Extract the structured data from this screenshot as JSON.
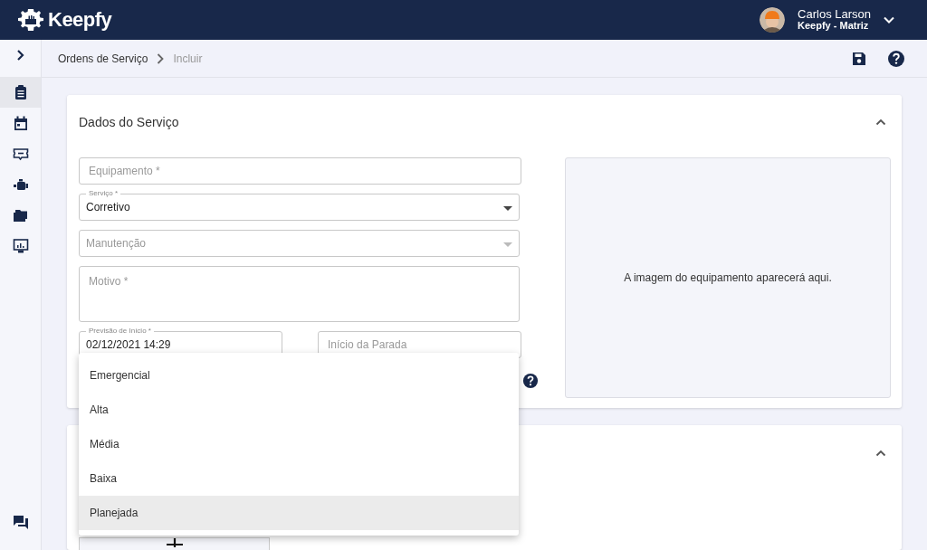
{
  "header": {
    "brand": "Keepfy",
    "user_name": "Carlos Larson",
    "organization": "Keepfy - Matriz"
  },
  "breadcrumbs": [
    "Ordens de Serviço",
    "Incluir"
  ],
  "sidebar": {
    "items": [
      {
        "selected": true
      },
      {
        "selected": false
      },
      {
        "selected": false
      },
      {
        "selected": false
      },
      {
        "selected": false
      },
      {
        "selected": false
      }
    ]
  },
  "service_card": {
    "title": "Dados do Serviço",
    "expanded": true,
    "fields": [
      {
        "kind": "text",
        "placeholder": "Equipamento *"
      },
      {
        "kind": "select",
        "label": "Serviço *",
        "value": "Corretivo"
      },
      {
        "kind": "select",
        "placeholder": "Manutenção"
      },
      {
        "kind": "textarea",
        "placeholder": "Motivo *"
      }
    ],
    "date_fields": [
      {
        "label": "Previsão de Início *",
        "value": "02/12/2021 14:29"
      },
      {
        "placeholder": "Início da Parada"
      }
    ],
    "image_placeholder": "A imagem do equipamento aparecerá aqui."
  },
  "second_card": {
    "expanded": true
  },
  "priority_menu": [
    {
      "label": "Emergencial",
      "selected": false
    },
    {
      "label": "Alta",
      "selected": false
    },
    {
      "label": "Média",
      "selected": false
    },
    {
      "label": "Baixa",
      "selected": false
    },
    {
      "label": "Planejada",
      "selected": true
    }
  ]
}
